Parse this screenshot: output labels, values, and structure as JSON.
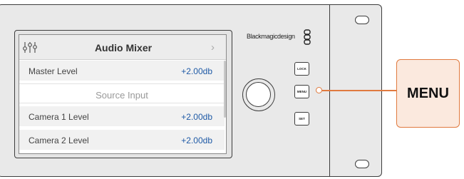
{
  "device": {
    "brand": "Blackmagicdesign",
    "brand_logo": "blackmagic-logo-icon"
  },
  "screen": {
    "title": "Audio Mixer",
    "header_icon": "mixer-sliders-icon",
    "chevron": "›",
    "rows": [
      {
        "label": "Master Level",
        "value": "+2.00db"
      },
      {
        "heading": "Source Input"
      },
      {
        "label": "Camera 1 Level",
        "value": "+2.00db"
      },
      {
        "label": "Camera 2 Level",
        "value": "+2.00db"
      }
    ]
  },
  "buttons": {
    "lock": "LOCK",
    "menu": "MENU",
    "set": "SET"
  },
  "callout": {
    "label": "MENU",
    "color": "#e07a3f"
  }
}
